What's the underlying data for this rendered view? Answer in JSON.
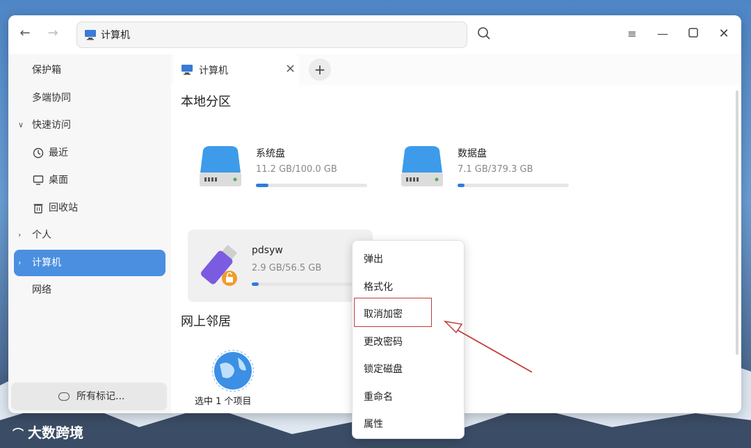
{
  "colors": {
    "accent": "#4a8fe0",
    "progress": "#2d7be0",
    "annotation": "#c23a3a"
  },
  "titlebar": {
    "path": "计算机",
    "icons": [
      "back-arrow-icon",
      "forward-arrow-icon",
      "search-icon",
      "menu-icon",
      "minimize-icon",
      "maximize-icon",
      "close-icon"
    ]
  },
  "sidebar": {
    "items": [
      {
        "label": "保护箱"
      },
      {
        "label": "多端协同"
      },
      {
        "label": "快速访问",
        "arrow": "∨"
      },
      {
        "label": "最近",
        "icon": "clock-icon"
      },
      {
        "label": "桌面",
        "icon": "desktop-icon"
      },
      {
        "label": "回收站",
        "icon": "trash-icon"
      },
      {
        "label": "个人",
        "arrow": "›"
      },
      {
        "label": "计算机",
        "arrow": "›",
        "selected": true
      },
      {
        "label": "网络"
      }
    ],
    "tags_label": "所有标记..."
  },
  "tab": {
    "label": "计算机",
    "close": "×",
    "add": "+"
  },
  "sections": {
    "local": "本地分区",
    "network": "网上邻居"
  },
  "disks": [
    {
      "name": "系统盘",
      "size": "11.2 GB/100.0 GB",
      "used_fraction": 0.112
    },
    {
      "name": "数据盘",
      "size": "7.1 GB/379.3 GB",
      "used_fraction": 0.019
    },
    {
      "name": "pdsyw",
      "size": "2.9 GB/56.5 GB",
      "used_fraction": 0.051
    }
  ],
  "network_item": {
    "label": "选中 1 个项目"
  },
  "context_menu": {
    "items": [
      "弹出",
      "格式化",
      "取消加密",
      "更改密码",
      "锁定磁盘",
      "重命名",
      "属性"
    ],
    "highlighted": "取消加密"
  },
  "watermark": {
    "text": "大数跨境"
  }
}
